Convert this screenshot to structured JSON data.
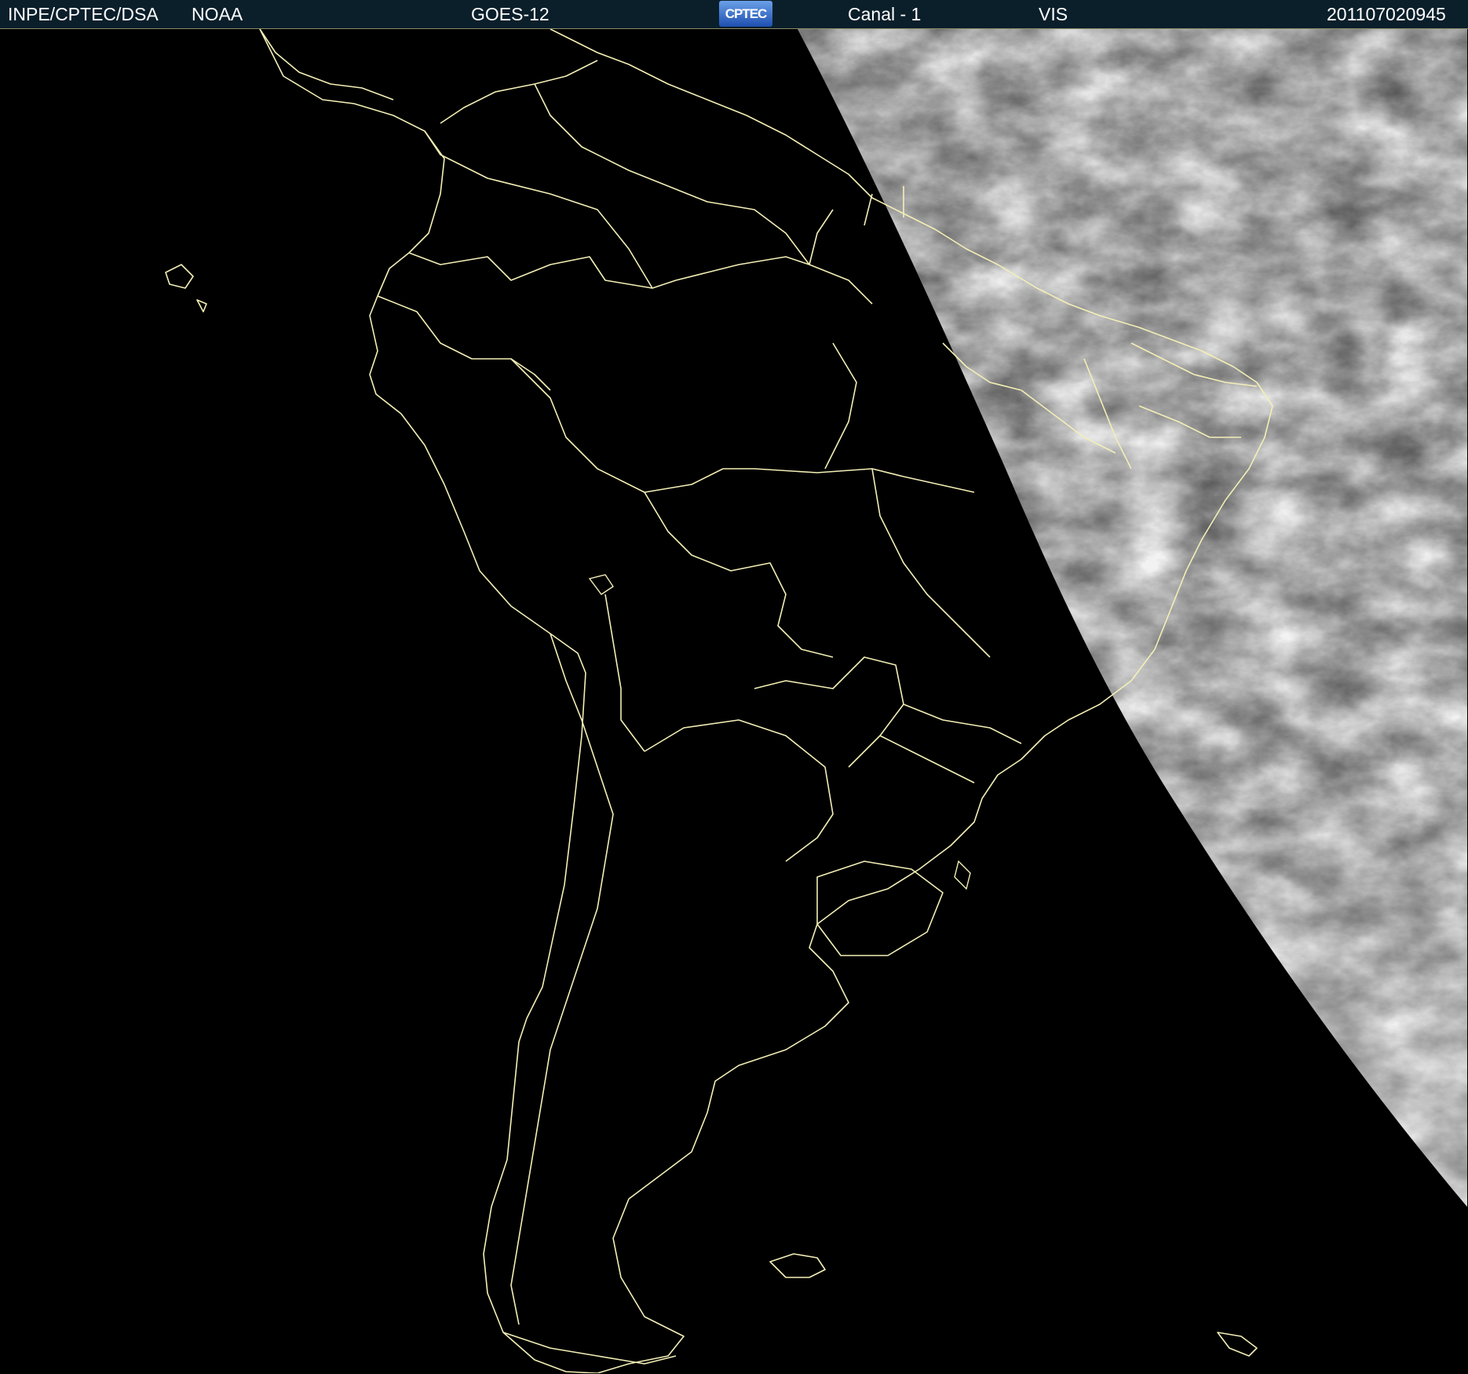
{
  "header": {
    "agency": "INPE/CPTEC/DSA",
    "provider": "NOAA",
    "satellite": "GOES-12",
    "logo_text": "CPTEC",
    "channel": "Canal - 1",
    "band": "VIS",
    "timestamp": "201107020945"
  },
  "colors": {
    "header_background": "#0b1f2b",
    "border_lines": "#f3efb6",
    "night_side": "#000000",
    "day_side_cloud": "#8c8c8c"
  },
  "map": {
    "projection_view": "South America, visible channel, terminator with daylight on the east",
    "layers": [
      "country-borders",
      "state-borders",
      "coastlines",
      "day-night-terminator",
      "cloud-imagery"
    ]
  }
}
